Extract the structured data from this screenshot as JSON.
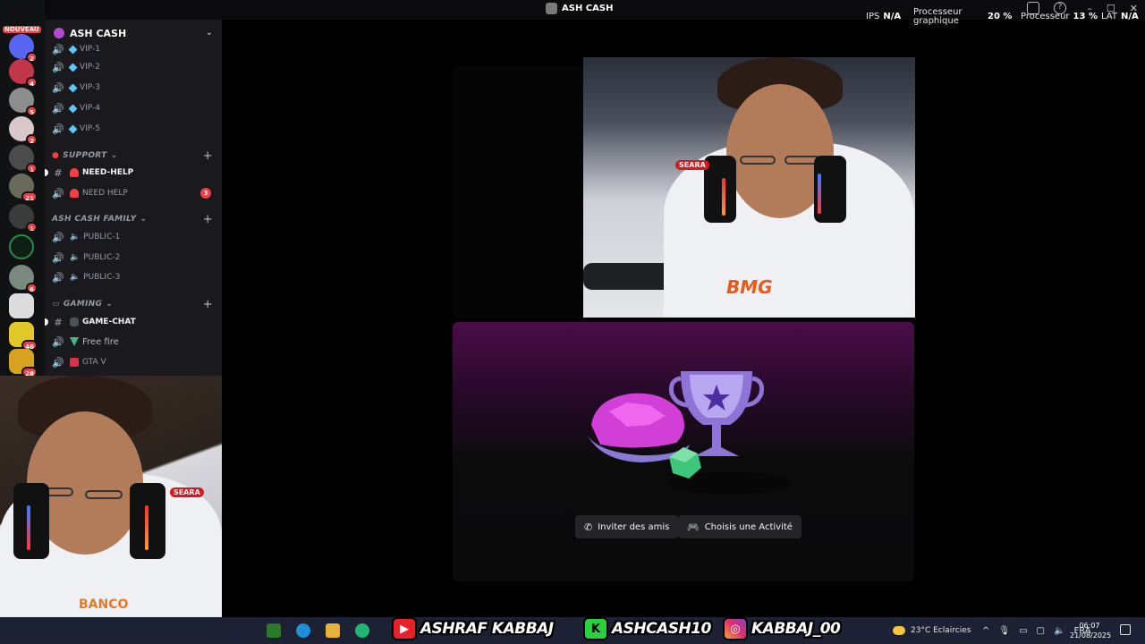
{
  "window": {
    "title": "ASH CASH",
    "controls": [
      "–",
      "☐",
      "✕"
    ]
  },
  "overlay_stats": {
    "ips_label": "IPS",
    "ips_value": "N/A",
    "gpu_label_line1": "Processeur",
    "gpu_label_line2": "graphique",
    "gpu_value": "20 %",
    "cpu_label": "Processeur",
    "cpu_value": "13 %",
    "lat_label": "LAT",
    "lat_value": "N/A"
  },
  "rail": {
    "new_label": "NOUVEAU",
    "top_badge": "4",
    "servers": [
      {
        "badge": "2",
        "color": "#5865f2"
      },
      {
        "badge": "4",
        "color": "#c2364a"
      },
      {
        "badge": "5",
        "color": "#8d8d8d"
      },
      {
        "badge": "2",
        "color": "#d9c7c9"
      },
      {
        "badge": "1",
        "color": "#4b4b4b"
      },
      {
        "badge": "21",
        "color": "#6a6a5a"
      },
      {
        "badge": "1",
        "color": "#3b3b3b"
      },
      {
        "badge": "",
        "color": "#0d1f14"
      },
      {
        "badge": "6",
        "color": "#7a8a7f"
      },
      {
        "badge": "",
        "color": "#dcdcdc"
      },
      {
        "badge": "46",
        "color": "#e1c92a"
      },
      {
        "badge": "28",
        "color": "#d7a21f"
      }
    ]
  },
  "sidebar": {
    "server_name": "ASH CASH",
    "vip_channels": [
      "VIP-1",
      "VIP-2",
      "VIP-3",
      "VIP-4",
      "VIP-5"
    ],
    "support_category": "SUPPORT",
    "support_channels": [
      {
        "name": "NEED-HELP",
        "type": "#",
        "bold": true
      },
      {
        "name": "NEED HELP",
        "type": "voice",
        "badge": "3"
      }
    ],
    "family_category": "ASH CASH FAMILY",
    "family_channels": [
      "PUBLIC-1",
      "PUBLIC-2",
      "PUBLIC-3"
    ],
    "gaming_category": "GAMING",
    "gaming_channels": [
      {
        "name": "GAME-CHAT",
        "type": "#",
        "bold": true
      },
      {
        "name": "Free fire",
        "type": "voice"
      },
      {
        "name": "GTA V",
        "type": "voice"
      }
    ]
  },
  "webcam": {
    "sponsor_logo": "SEARA",
    "shirt_text": "BANCO"
  },
  "activity": {
    "invite_label": "Inviter des amis",
    "choose_label": "Choisis une Activité"
  },
  "social": {
    "youtube": "ASHRAF KABBAJ",
    "kick": "ASHCASH10",
    "instagram": "KABBAJ_00"
  },
  "taskbar": {
    "weather": "23°C  Eclaircies",
    "lang": "FRA",
    "time": "06:07",
    "date": "21/08/2025"
  },
  "colors": {
    "discord_red": "#f23f43",
    "sidebar_bg": "#1a1a1e",
    "rail_bg": "#111214",
    "activity_purple": "#4a0d48"
  }
}
